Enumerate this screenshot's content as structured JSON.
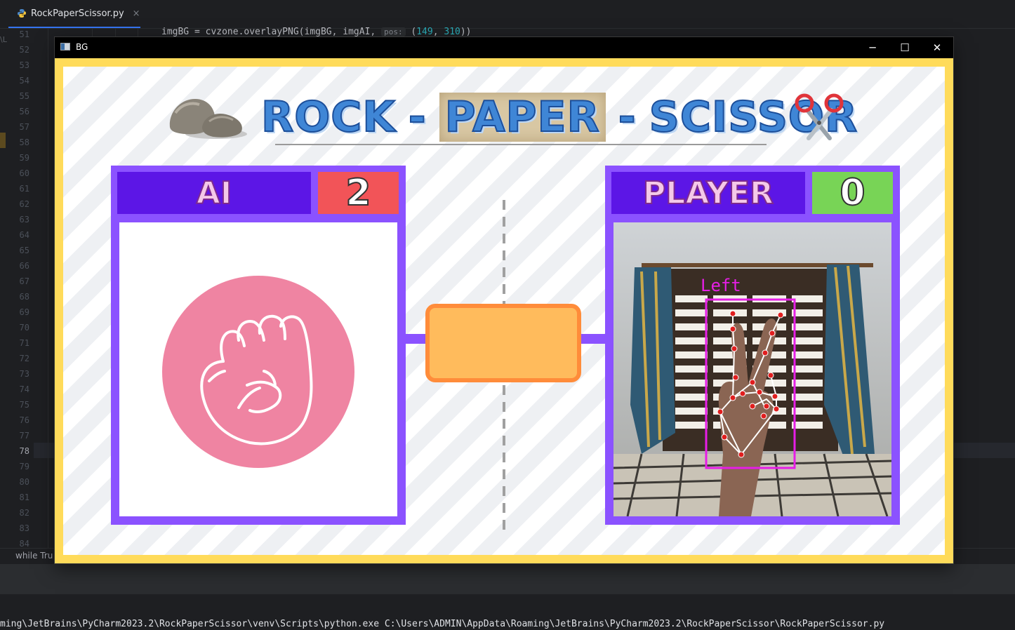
{
  "ide": {
    "file_tab": {
      "name": "RockPaperScissor.py",
      "close_glyph": "×",
      "icon": "python-file-icon"
    },
    "line_numbers": [
      "51",
      "52",
      "53",
      "54",
      "55",
      "56",
      "57",
      "58",
      "59",
      "60",
      "61",
      "62",
      "63",
      "64",
      "65",
      "66",
      "67",
      "68",
      "69",
      "70",
      "71",
      "72",
      "73",
      "74",
      "75",
      "76",
      "77",
      "78",
      "79",
      "80",
      "81",
      "82",
      "83",
      "84"
    ],
    "current_line": "78",
    "code_line_51": {
      "text": "imgBG = cvzone.overlayPNG(imgBG, imgAI, ",
      "param_hint": "pos:",
      "pos_open": " (",
      "x": "149",
      "sep": ", ",
      "y": "310",
      "close": "))"
    },
    "left_edge_fragment": "\\L",
    "status_breadcrumb": "while Tru",
    "console_line": "ming\\JetBrains\\PyCharm2023.2\\RockPaperScissor\\venv\\Scripts\\python.exe C:\\Users\\ADMIN\\AppData\\Roaming\\JetBrains\\PyCharm2023.2\\RockPaperScissor\\RockPaperScissor.py"
  },
  "window": {
    "title": "BG",
    "minimize_glyph": "─",
    "maximize_glyph": "☐",
    "close_glyph": "✕"
  },
  "game": {
    "title_rock": "ROCK",
    "title_dash1": "-",
    "title_paper": "PAPER",
    "title_dash2": "-",
    "title_scissor": "SCISSOR",
    "ai": {
      "label": "AI",
      "score": "2",
      "move": "rock"
    },
    "player": {
      "label": "PLAYER",
      "score": "0",
      "hand_label": "Left",
      "gesture": "scissor"
    },
    "colors": {
      "frame_yellow": "#ffdb5a",
      "panel_purple": "#8b52ff",
      "name_bar": "#5c16e6",
      "ai_score_bg": "#f25458",
      "player_score_bg": "#78d456",
      "result_box": "#ffbb5c",
      "result_border": "#ff8c3a",
      "fist_circle": "#ef84a2",
      "hand_box": "#e61ee6"
    }
  }
}
